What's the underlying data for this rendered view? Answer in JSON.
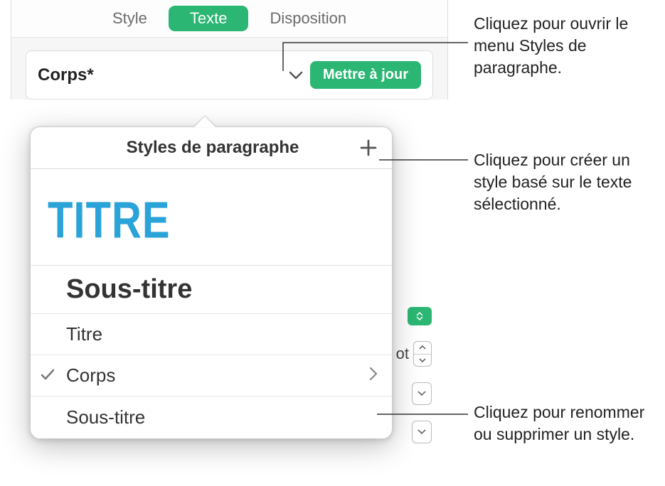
{
  "tabs": {
    "style": "Style",
    "texte": "Texte",
    "disposition": "Disposition"
  },
  "current_style": {
    "label": "Corps*",
    "update_label": "Mettre à jour"
  },
  "popover": {
    "title": "Styles de paragraphe",
    "hero": "TITRE",
    "items": {
      "sous_titre_big": "Sous-titre",
      "titre": "Titre",
      "corps": "Corps",
      "sous_titre_small": "Sous-titre"
    }
  },
  "partial_text": "ot",
  "callouts": {
    "open_menu": "Cliquez pour ouvrir le menu Styles de paragraphe.",
    "create_style": "Cliquez pour créer un style basé sur le texte sélectionné.",
    "rename_delete": "Cliquez pour renommer ou supprimer un style."
  },
  "colors": {
    "accent": "#2bb673",
    "hero_blue": "#2aa3d8"
  }
}
